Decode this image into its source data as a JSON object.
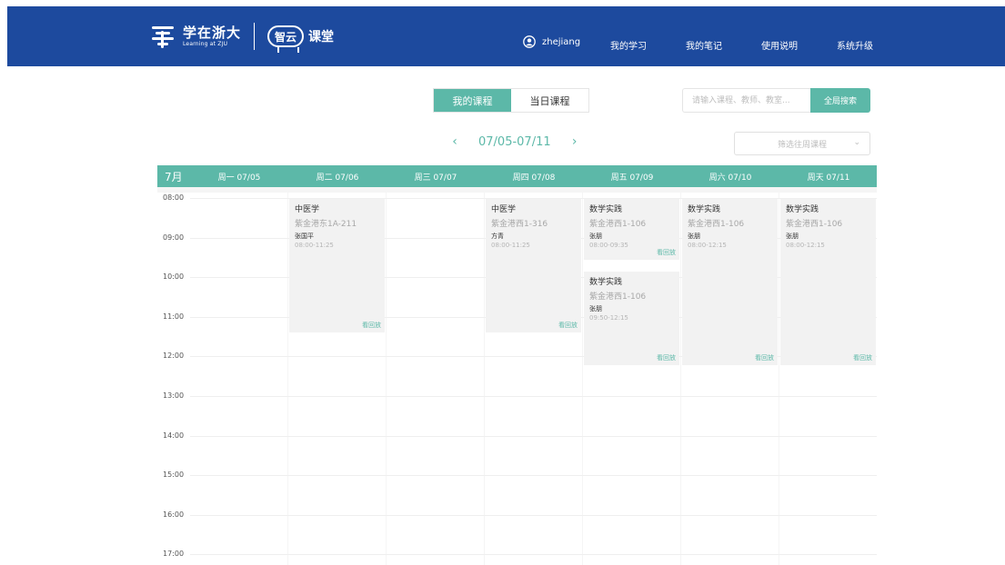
{
  "header": {
    "logo_cn": "学在浙大",
    "logo_en": "Learning at ZJU",
    "cloud_badge": "智云",
    "cloud_word": "课堂",
    "username": "zhejiang",
    "nav": [
      "我的学习",
      "我的笔记",
      "使用说明",
      "系统升级"
    ],
    "bg_color": "#1d4a9e"
  },
  "tabs": [
    "我的课程",
    "当日课程"
  ],
  "search": {
    "placeholder": "请输入课程、教师、教室...",
    "button": "全局搜索"
  },
  "week": {
    "label": "07/05-07/11",
    "prev_icon": "chevron-left-icon",
    "next_icon": "chevron-right-icon"
  },
  "filter": {
    "placeholder": "筛选往周课程"
  },
  "calendar": {
    "month": "7月",
    "accent_color": "#5cb8a8",
    "days": [
      "周一 07/05",
      "周二 07/06",
      "周三 07/07",
      "周四 07/08",
      "周五 07/09",
      "周六 07/10",
      "周天 07/11"
    ],
    "hours": [
      "08:00",
      "09:00",
      "10:00",
      "11:00",
      "12:00",
      "13:00",
      "14:00",
      "15:00",
      "16:00",
      "17:00"
    ],
    "replay_label": "看回放",
    "events": [
      {
        "day": 1,
        "name": "中医学",
        "room": "紫金港东1A-211",
        "teacher": "张国平",
        "time": "08:00-11:25"
      },
      {
        "day": 3,
        "name": "中医学",
        "room": "紫金港西1-316",
        "teacher": "方青",
        "time": "08:00-11:25"
      },
      {
        "day": 4,
        "name": "数学实践",
        "room": "紫金港西1-106",
        "teacher": "张朋",
        "time": "08:00-09:35"
      },
      {
        "day": 4,
        "name": "数学实践",
        "room": "紫金港西1-106",
        "teacher": "张朋",
        "time": "09:50-12:15"
      },
      {
        "day": 5,
        "name": "数学实践",
        "room": "紫金港西1-106",
        "teacher": "张朋",
        "time": "08:00-12:15"
      },
      {
        "day": 6,
        "name": "数学实践",
        "room": "紫金港西1-106",
        "teacher": "张朋",
        "time": "08:00-12:15"
      }
    ]
  }
}
